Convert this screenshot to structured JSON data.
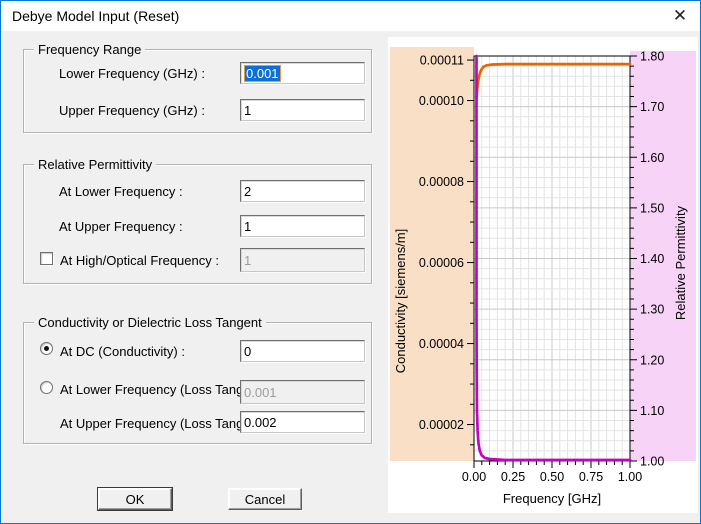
{
  "window": {
    "title": "Debye Model Input (Reset)",
    "close_icon": "✕"
  },
  "form": {
    "groups": [
      {
        "title": "Frequency Range",
        "fields": [
          {
            "label": "Lower Frequency (GHz) :",
            "value": "0.001",
            "state": "selected"
          },
          {
            "label": "Upper Frequency (GHz) :",
            "value": "1",
            "state": "normal"
          }
        ]
      },
      {
        "title": "Relative Permittivity",
        "fields": [
          {
            "label": "At Lower Frequency :",
            "value": "2",
            "state": "normal"
          },
          {
            "label": "At Upper Frequency :",
            "value": "1",
            "state": "normal"
          },
          {
            "label": "At High/Optical Frequency :",
            "value": "1",
            "control": "checkbox",
            "checked": false,
            "state": "disabled"
          }
        ]
      },
      {
        "title": "Conductivity or Dielectric Loss Tangent",
        "fields": [
          {
            "label": "At DC (Conductivity) :",
            "value": "0",
            "control": "radio",
            "checked": true,
            "state": "normal"
          },
          {
            "label": "At Lower Frequency (Loss Tangent) :",
            "value": "0.001",
            "control": "radio",
            "checked": false,
            "state": "disabled"
          },
          {
            "label": "At Upper Frequency (Loss Tangent) :",
            "value": "0.002",
            "state": "normal"
          }
        ]
      }
    ],
    "buttons": [
      {
        "label": "OK",
        "default": true
      },
      {
        "label": "Cancel",
        "default": false
      }
    ]
  },
  "chart_data": {
    "type": "line",
    "xlabel": "Frequency [GHz]",
    "ylabel_left": "Conductivity [siemens/m]",
    "ylabel_right": "Relative Permittivity",
    "xlim": [
      0,
      1
    ],
    "ylim_left": [
      1.1e-05,
      0.000111
    ],
    "ylim_right": [
      1.0,
      1.8
    ],
    "x_major_ticks": [
      {
        "v": 0.0,
        "label": "0.00"
      },
      {
        "v": 0.25,
        "label": "0.25"
      },
      {
        "v": 0.5,
        "label": "0.50"
      },
      {
        "v": 0.75,
        "label": "0.75"
      },
      {
        "v": 1.0,
        "label": "1.00"
      }
    ],
    "left_major_ticks": [
      {
        "v": 2e-05,
        "label": "0.00002"
      },
      {
        "v": 4e-05,
        "label": "0.00004"
      },
      {
        "v": 6e-05,
        "label": "0.00006"
      },
      {
        "v": 8e-05,
        "label": "0.00008"
      },
      {
        "v": 0.0001,
        "label": "0.00010"
      },
      {
        "v": 0.00011,
        "label": "0.00011"
      }
    ],
    "right_major_ticks": [
      {
        "v": 1.0,
        "label": "1.00"
      },
      {
        "v": 1.1,
        "label": "1.10"
      },
      {
        "v": 1.2,
        "label": "1.20"
      },
      {
        "v": 1.3,
        "label": "1.30"
      },
      {
        "v": 1.4,
        "label": "1.40"
      },
      {
        "v": 1.5,
        "label": "1.50"
      },
      {
        "v": 1.6,
        "label": "1.60"
      },
      {
        "v": 1.7,
        "label": "1.70"
      },
      {
        "v": 1.8,
        "label": "1.80"
      }
    ],
    "x_minor_step": 0.05,
    "left_minor_step": 5e-06,
    "right_minor_step": 0.02,
    "grid": true,
    "legend": "none",
    "colors": {
      "left_band": "#f8dfc5",
      "right_band": "#f7d3f7",
      "grid_major": "#c8c8c8",
      "grid_minor": "#e4e4e4",
      "axis": "#000000"
    },
    "series": [
      {
        "name": "conductivity",
        "axis": "left",
        "color": "#ed6300",
        "points": [
          [
            0.016,
            0.0001005
          ],
          [
            0.019,
            0.000102
          ],
          [
            0.024,
            0.000104
          ],
          [
            0.03,
            0.0001055
          ],
          [
            0.038,
            0.0001068
          ],
          [
            0.048,
            0.0001077
          ],
          [
            0.06,
            0.0001083
          ],
          [
            0.08,
            0.0001087
          ],
          [
            0.12,
            0.0001089
          ],
          [
            0.2,
            0.000109
          ],
          [
            0.5,
            0.000109
          ],
          [
            1.0,
            0.000109
          ]
        ]
      },
      {
        "name": "relative_permittivity",
        "axis": "right",
        "color": "#c203c2",
        "points": [
          [
            0.016,
            1.8
          ],
          [
            0.016,
            1.3
          ],
          [
            0.017,
            1.18
          ],
          [
            0.019,
            1.1
          ],
          [
            0.023,
            1.06
          ],
          [
            0.029,
            1.035
          ],
          [
            0.037,
            1.02
          ],
          [
            0.05,
            1.011
          ],
          [
            0.07,
            1.006
          ],
          [
            0.1,
            1.004
          ],
          [
            0.2,
            1.002
          ],
          [
            1.0,
            1.002
          ]
        ]
      }
    ]
  }
}
